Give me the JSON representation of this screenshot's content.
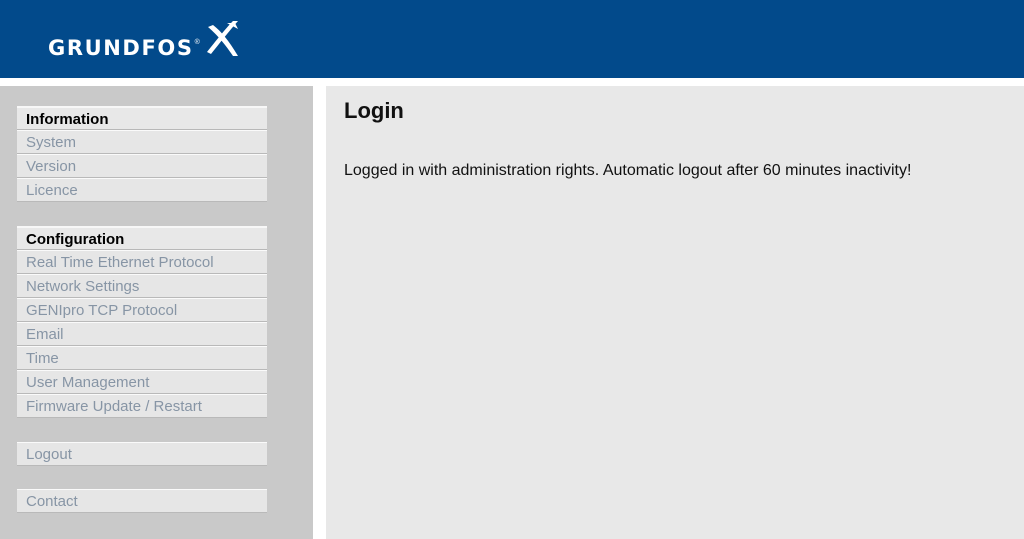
{
  "header": {
    "logo_text": "GRUNDFOS",
    "logo_reg": "®",
    "brand_color": "#024a8b"
  },
  "sidebar": {
    "information": {
      "title": "Information",
      "items": [
        {
          "label": "System"
        },
        {
          "label": "Version"
        },
        {
          "label": "Licence"
        }
      ]
    },
    "configuration": {
      "title": "Configuration",
      "items": [
        {
          "label": "Real Time Ethernet Protocol"
        },
        {
          "label": "Network Settings"
        },
        {
          "label": "GENIpro TCP Protocol"
        },
        {
          "label": "Email"
        },
        {
          "label": "Time"
        },
        {
          "label": "User Management"
        },
        {
          "label": "Firmware Update / Restart"
        }
      ]
    },
    "logout": {
      "label": "Logout"
    },
    "contact": {
      "label": "Contact"
    }
  },
  "main": {
    "title": "Login",
    "message": "Logged in with administration rights. Automatic logout after 60 minutes inactivity!"
  }
}
